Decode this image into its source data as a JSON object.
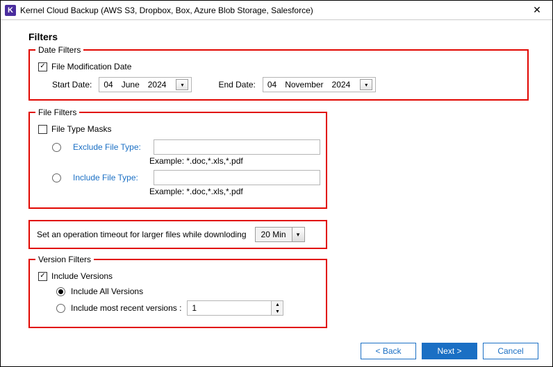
{
  "window": {
    "title": "Kernel Cloud Backup (AWS S3, Dropbox, Box, Azure Blob Storage, Salesforce)"
  },
  "header": {
    "filters_label": "Filters"
  },
  "date_filters": {
    "legend": "Date Filters",
    "mod_date_label": "File Modification Date",
    "mod_date_checked": true,
    "start_label": "Start Date:",
    "start_day": "04",
    "start_month": "June",
    "start_year": "2024",
    "end_label": "End Date:",
    "end_day": "04",
    "end_month": "November",
    "end_year": "2024"
  },
  "file_filters": {
    "legend": "File Filters",
    "masks_label": "File Type Masks",
    "masks_checked": false,
    "exclude_label": "Exclude File Type:",
    "exclude_value": "",
    "exclude_example": "Example:  *.doc,*.xls,*.pdf",
    "include_label": "Include File Type:",
    "include_value": "",
    "include_example": "Example:  *.doc,*.xls,*.pdf"
  },
  "timeout": {
    "label": "Set an operation timeout for larger files while downloding",
    "value": "20 Min"
  },
  "version_filters": {
    "legend": "Version Filters",
    "include_versions_label": "Include Versions",
    "include_versions_checked": true,
    "all_label": "Include All Versions",
    "all_selected": true,
    "recent_label": "Include most recent versions :",
    "recent_selected": false,
    "recent_value": "1"
  },
  "buttons": {
    "back": "< Back",
    "next": "Next >",
    "cancel": "Cancel"
  }
}
